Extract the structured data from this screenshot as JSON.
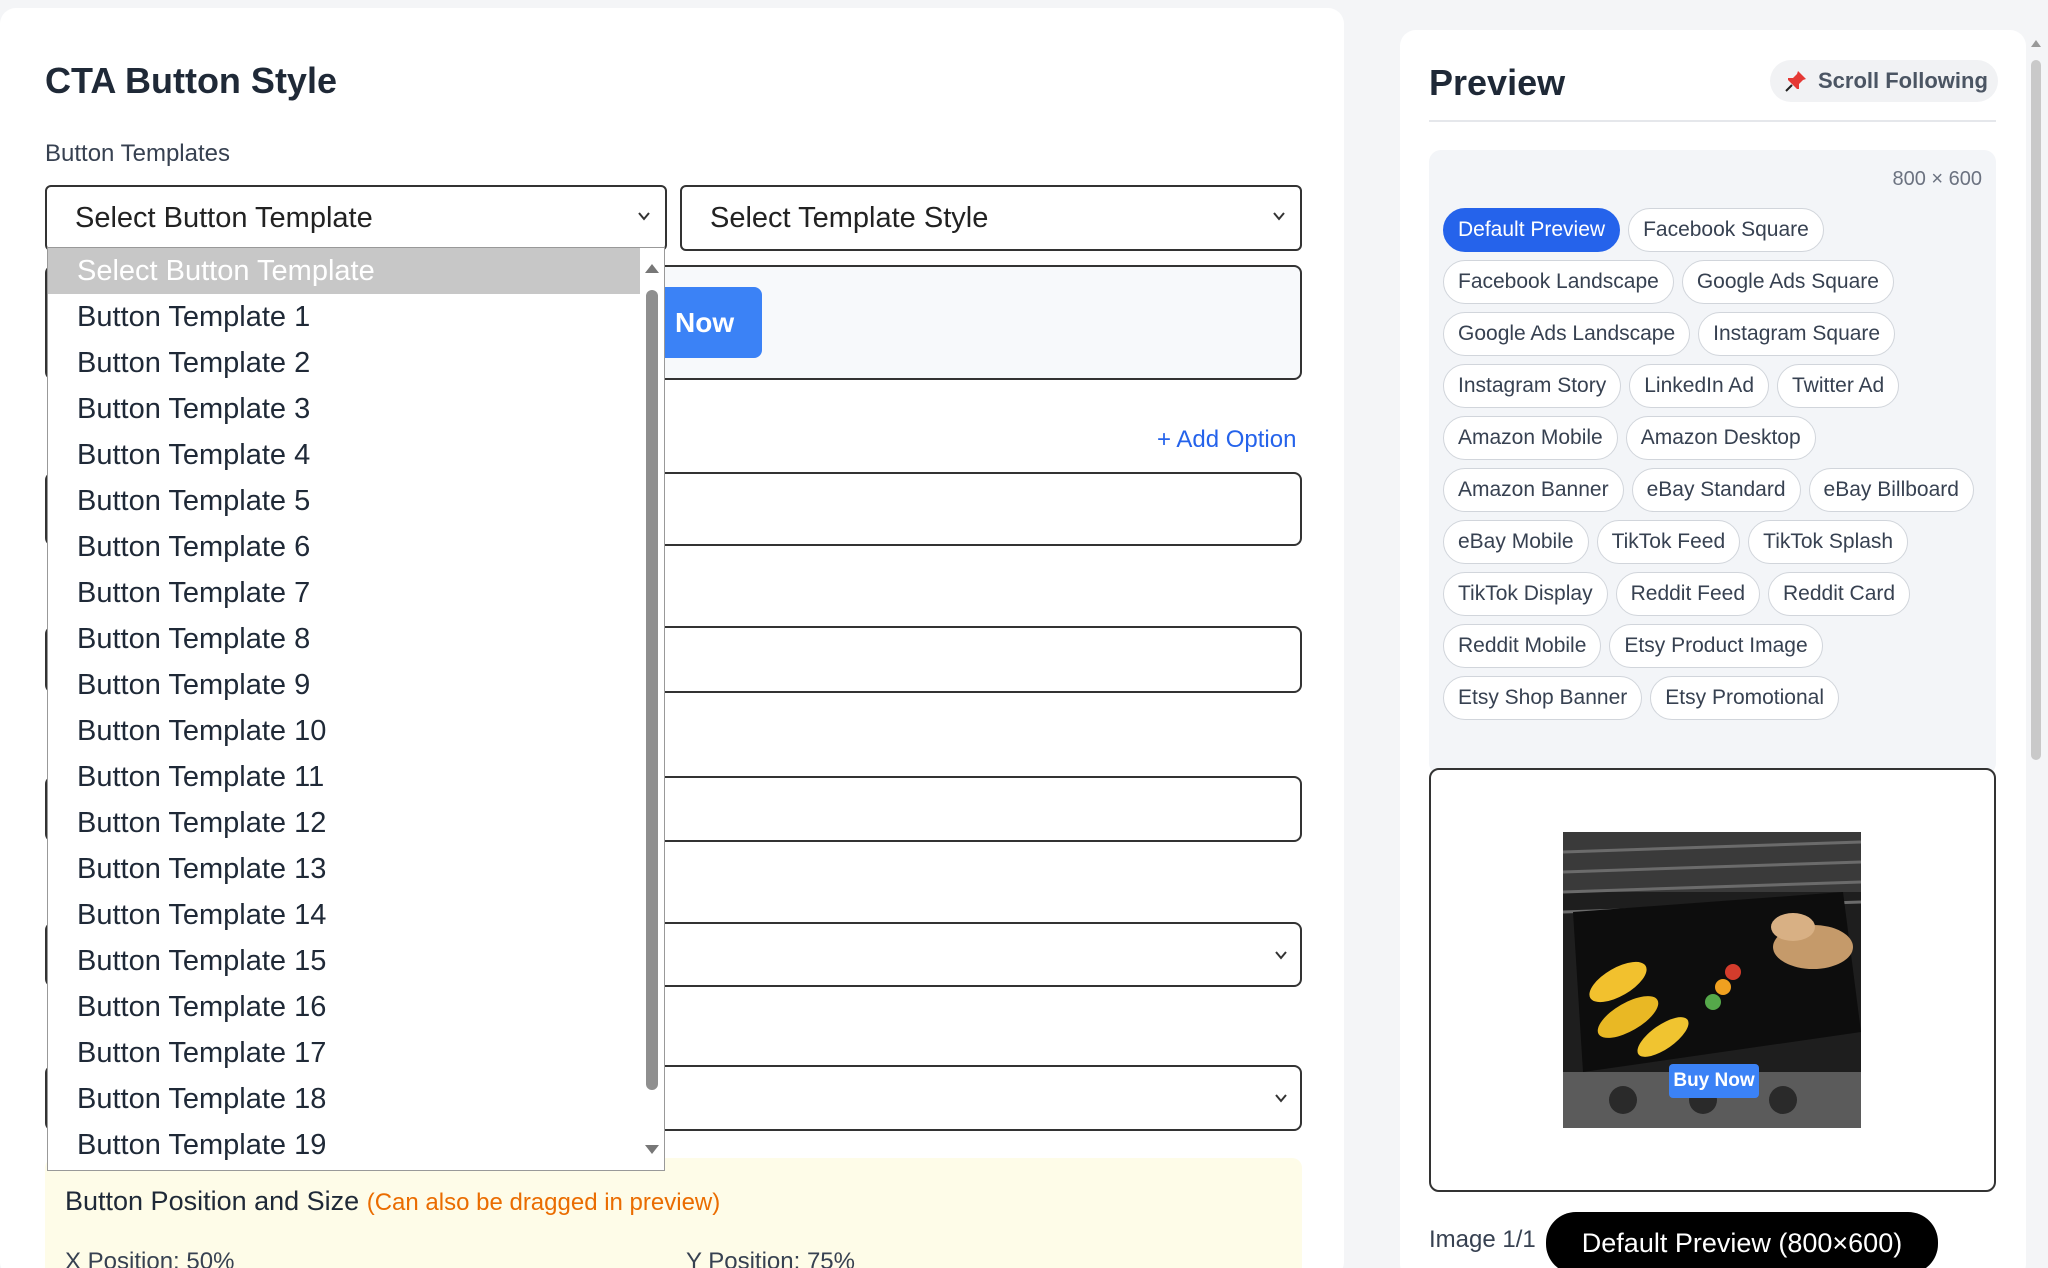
{
  "editor": {
    "title": "CTA Button Style",
    "templates_label": "Button Templates",
    "template_select_value": "Select Button Template",
    "style_select_value": "Select Template Style",
    "sample_button_text": "Now",
    "add_option": "+ Add Option",
    "position": {
      "title": "Button Position and Size",
      "hint": "(Can also be dragged in preview)",
      "x": "X Position: 50%",
      "y": "Y Position: 75%"
    }
  },
  "dropdown": {
    "items": [
      "Select Button Template",
      "Button Template 1",
      "Button Template 2",
      "Button Template 3",
      "Button Template 4",
      "Button Template 5",
      "Button Template 6",
      "Button Template 7",
      "Button Template 8",
      "Button Template 9",
      "Button Template 10",
      "Button Template 11",
      "Button Template 12",
      "Button Template 13",
      "Button Template 14",
      "Button Template 15",
      "Button Template 16",
      "Button Template 17",
      "Button Template 18",
      "Button Template 19"
    ],
    "selected_index": 0
  },
  "preview": {
    "title": "Preview",
    "scroll_following": "Scroll Following",
    "dimensions": "800 × 600",
    "formats": [
      "Default Preview",
      "Facebook Square",
      "Facebook Landscape",
      "Google Ads Square",
      "Google Ads Landscape",
      "Instagram Square",
      "Instagram Story",
      "LinkedIn Ad",
      "Twitter Ad",
      "Amazon Mobile",
      "Amazon Desktop",
      "Amazon Banner",
      "eBay Standard",
      "eBay Billboard",
      "eBay Mobile",
      "TikTok Feed",
      "TikTok Splash",
      "TikTok Display",
      "Reddit Feed",
      "Reddit Card",
      "Reddit Mobile",
      "Etsy Product Image",
      "Etsy Shop Banner",
      "Etsy Promotional"
    ],
    "active_format_index": 0,
    "image_button_text": "Buy Now",
    "image_counter": "Image 1/1",
    "current_format_pill": "Default Preview (800×600)"
  },
  "colors": {
    "accent": "#2563eb",
    "button_blue": "#3b82f6",
    "hint_orange": "#ea6c00",
    "position_card_bg": "#fefce8"
  }
}
